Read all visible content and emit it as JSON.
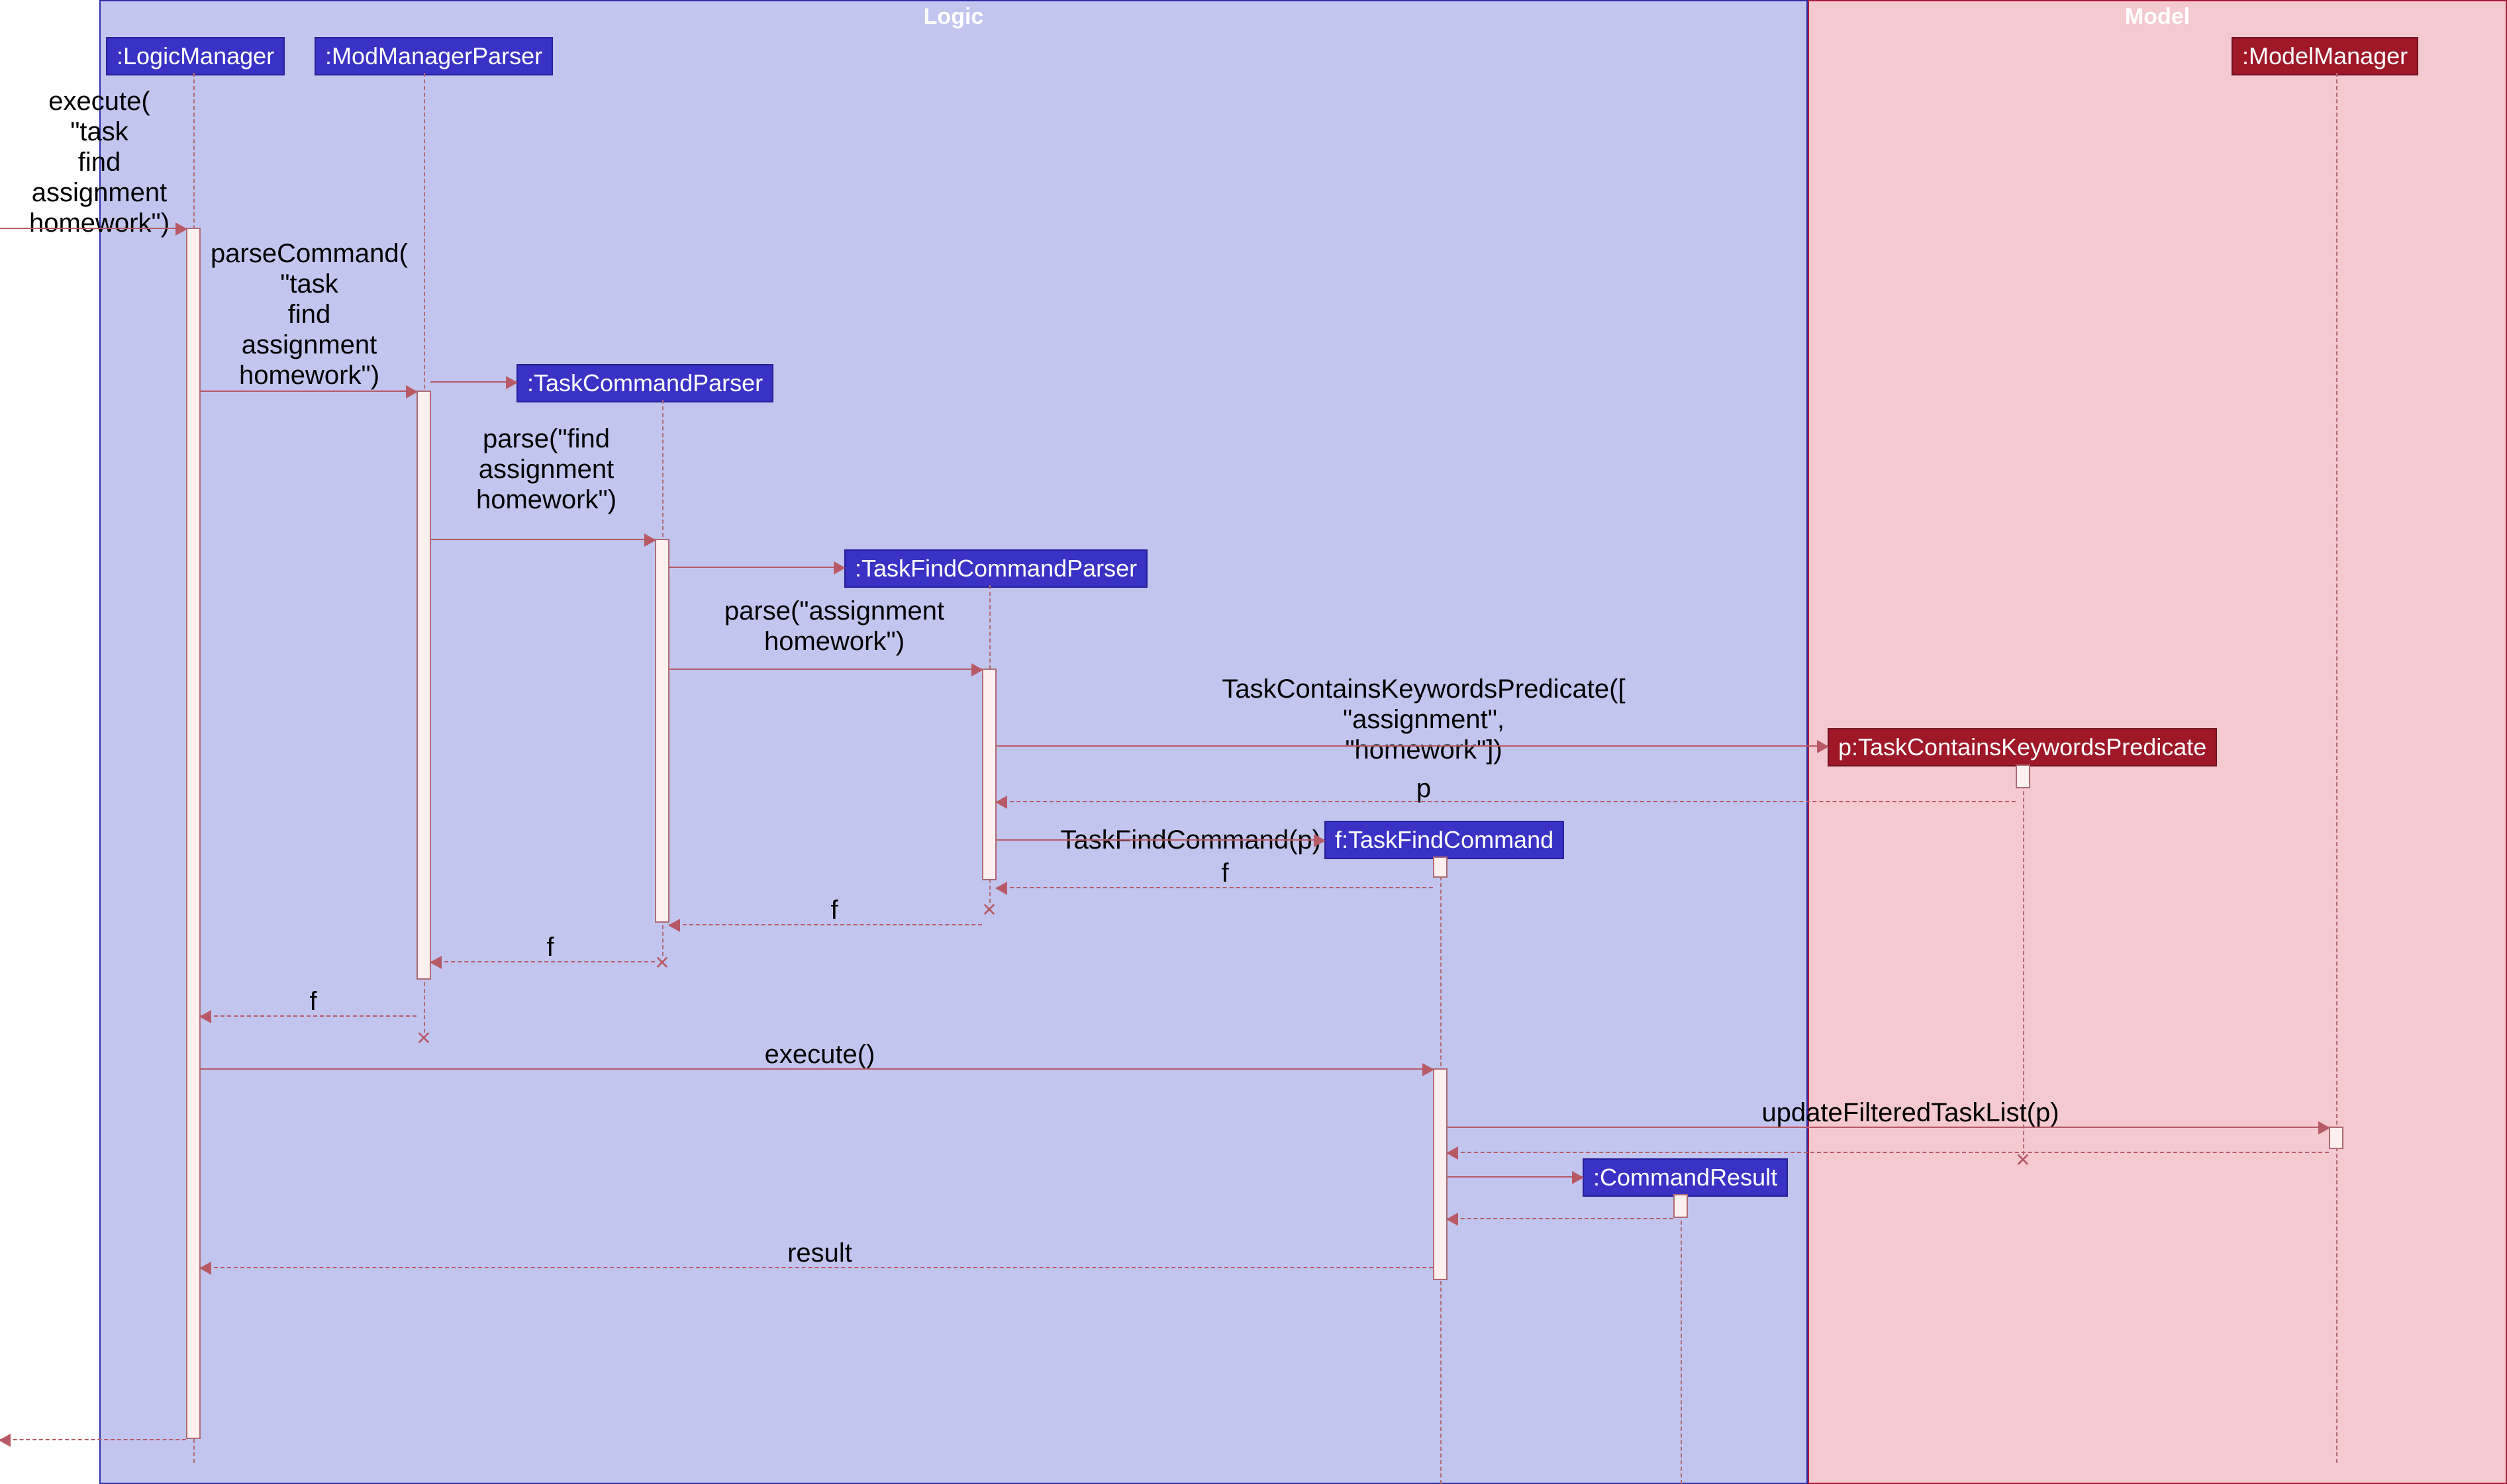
{
  "partitions": {
    "logic": "Logic",
    "model": "Model"
  },
  "lifelines": {
    "logicManager": ":LogicManager",
    "modManagerParser": ":ModManagerParser",
    "taskCommandParser": ":TaskCommandParser",
    "taskFindCommandParser": ":TaskFindCommandParser",
    "predicate": "p:TaskContainsKeywordsPredicate",
    "taskFindCommand": "f:TaskFindCommand",
    "commandResult": ":CommandResult",
    "modelManager": ":ModelManager"
  },
  "messages": {
    "execute": "execute(\n\"task\nfind\nassignment\nhomework\")",
    "parseCommand": "parseCommand(\n\"task\nfind\nassignment\nhomework\")",
    "parse1": "parse(\"find\nassignment\nhomework\")",
    "parse2": "parse(\"assignment\nhomework\")",
    "predicateNew": "TaskContainsKeywordsPredicate([\n\"assignment\",\n\"homework\"])",
    "cmdNew": "TaskFindCommand(p)",
    "p": "p",
    "f": "f",
    "execute2": "execute()",
    "update": "updateFilteredTaskList(p)",
    "result": "result"
  }
}
